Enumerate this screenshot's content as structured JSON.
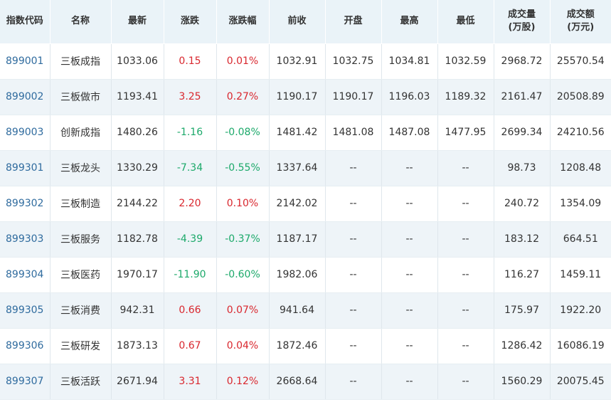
{
  "colors": {
    "header_bg": "#eaf3f8",
    "row_alt_bg": "#eef4f8",
    "code_link": "#2f6b9e",
    "up_red": "#d9272e",
    "down_green": "#1ca96a"
  },
  "table": {
    "headers": [
      {
        "line1": "指数代码",
        "line2": ""
      },
      {
        "line1": "名称",
        "line2": ""
      },
      {
        "line1": "最新",
        "line2": ""
      },
      {
        "line1": "涨跌",
        "line2": ""
      },
      {
        "line1": "涨跌幅",
        "line2": ""
      },
      {
        "line1": "前收",
        "line2": ""
      },
      {
        "line1": "开盘",
        "line2": ""
      },
      {
        "line1": "最高",
        "line2": ""
      },
      {
        "line1": "最低",
        "line2": ""
      },
      {
        "line1": "成交量",
        "line2": "(万股)"
      },
      {
        "line1": "成交额",
        "line2": "(万元)"
      }
    ],
    "rows": [
      {
        "code": "899001",
        "name": "三板成指",
        "latest": "1033.06",
        "change": "0.15",
        "change_pct": "0.01%",
        "prev_close": "1032.91",
        "open": "1032.75",
        "high": "1034.81",
        "low": "1032.59",
        "volume": "2968.72",
        "amount": "25570.54",
        "direction": "up"
      },
      {
        "code": "899002",
        "name": "三板做市",
        "latest": "1193.41",
        "change": "3.25",
        "change_pct": "0.27%",
        "prev_close": "1190.17",
        "open": "1190.17",
        "high": "1196.03",
        "low": "1189.32",
        "volume": "2161.47",
        "amount": "20508.89",
        "direction": "up"
      },
      {
        "code": "899003",
        "name": "创新成指",
        "latest": "1480.26",
        "change": "-1.16",
        "change_pct": "-0.08%",
        "prev_close": "1481.42",
        "open": "1481.08",
        "high": "1487.08",
        "low": "1477.95",
        "volume": "2699.34",
        "amount": "24210.56",
        "direction": "down"
      },
      {
        "code": "899301",
        "name": "三板龙头",
        "latest": "1330.29",
        "change": "-7.34",
        "change_pct": "-0.55%",
        "prev_close": "1337.64",
        "open": "--",
        "high": "--",
        "low": "--",
        "volume": "98.73",
        "amount": "1208.48",
        "direction": "down"
      },
      {
        "code": "899302",
        "name": "三板制造",
        "latest": "2144.22",
        "change": "2.20",
        "change_pct": "0.10%",
        "prev_close": "2142.02",
        "open": "--",
        "high": "--",
        "low": "--",
        "volume": "240.72",
        "amount": "1354.09",
        "direction": "up"
      },
      {
        "code": "899303",
        "name": "三板服务",
        "latest": "1182.78",
        "change": "-4.39",
        "change_pct": "-0.37%",
        "prev_close": "1187.17",
        "open": "--",
        "high": "--",
        "low": "--",
        "volume": "183.12",
        "amount": "664.51",
        "direction": "down"
      },
      {
        "code": "899304",
        "name": "三板医药",
        "latest": "1970.17",
        "change": "-11.90",
        "change_pct": "-0.60%",
        "prev_close": "1982.06",
        "open": "--",
        "high": "--",
        "low": "--",
        "volume": "116.27",
        "amount": "1459.11",
        "direction": "down"
      },
      {
        "code": "899305",
        "name": "三板消费",
        "latest": "942.31",
        "change": "0.66",
        "change_pct": "0.07%",
        "prev_close": "941.64",
        "open": "--",
        "high": "--",
        "low": "--",
        "volume": "175.97",
        "amount": "1922.20",
        "direction": "up"
      },
      {
        "code": "899306",
        "name": "三板研发",
        "latest": "1873.13",
        "change": "0.67",
        "change_pct": "0.04%",
        "prev_close": "1872.46",
        "open": "--",
        "high": "--",
        "low": "--",
        "volume": "1286.42",
        "amount": "16086.19",
        "direction": "up"
      },
      {
        "code": "899307",
        "name": "三板活跃",
        "latest": "2671.94",
        "change": "3.31",
        "change_pct": "0.12%",
        "prev_close": "2668.64",
        "open": "--",
        "high": "--",
        "low": "--",
        "volume": "1560.29",
        "amount": "20075.45",
        "direction": "up"
      }
    ]
  }
}
